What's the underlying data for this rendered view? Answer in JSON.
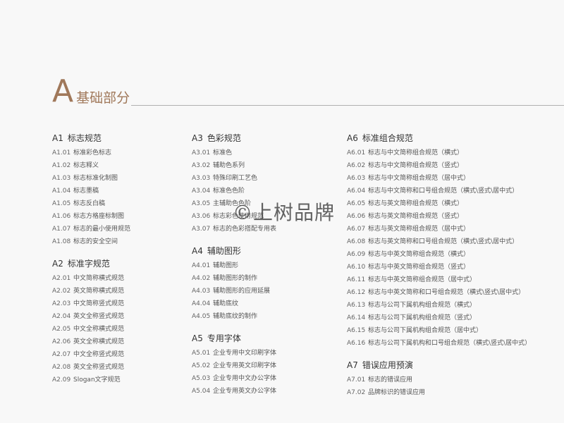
{
  "heading": {
    "letter": "A",
    "title": "基础部分"
  },
  "watermark": "©上树品牌",
  "columns": [
    [
      {
        "code": "A1",
        "title": "标志规范",
        "items": [
          [
            "A1.01",
            "标准彩色标志"
          ],
          [
            "A1.02",
            "标志释义"
          ],
          [
            "A1.03",
            "标志标准化制图"
          ],
          [
            "A1.04",
            "标志墨稿"
          ],
          [
            "A1.05",
            "标志反白稿"
          ],
          [
            "A1.06",
            "标志方格座标制图"
          ],
          [
            "A1.07",
            "标志的最小使用规范"
          ],
          [
            "A1.08",
            "标志的安全空间"
          ]
        ]
      },
      {
        "code": "A2",
        "title": "标准字规范",
        "items": [
          [
            "A2.01",
            "中文简称横式规范"
          ],
          [
            "A2.02",
            "英文简称横式规范"
          ],
          [
            "A2.03",
            "中文简称竖式规范"
          ],
          [
            "A2.04",
            "英文全称竖式规范"
          ],
          [
            "A2.05",
            "中文全称横式规范"
          ],
          [
            "A2.06",
            "英文全称横式规范"
          ],
          [
            "A2.07",
            "中文全称竖式规范"
          ],
          [
            "A2.08",
            "英文全称竖式规范"
          ],
          [
            "A2.09",
            "Slogan文字规范"
          ]
        ]
      }
    ],
    [
      {
        "code": "A3",
        "title": "色彩规范",
        "items": [
          [
            "A3.01",
            "标准色"
          ],
          [
            "A3.02",
            "辅助色系列"
          ],
          [
            "A3.03",
            "特殊印刷工艺色"
          ],
          [
            "A3.04",
            "标准色色阶"
          ],
          [
            "A3.05",
            "主辅助色色阶"
          ],
          [
            "A3.06",
            "标志彩色使用规范"
          ],
          [
            "A3.07",
            "标志的色彩搭配专用表"
          ]
        ]
      },
      {
        "code": "A4",
        "title": "辅助图形",
        "items": [
          [
            "A4.01",
            "辅助图形"
          ],
          [
            "A4.02",
            "辅助图形的制作"
          ],
          [
            "A4.03",
            "辅助图形的应用延展"
          ],
          [
            "A4.04",
            "辅助底纹"
          ],
          [
            "A4.05",
            "辅助底纹的制作"
          ]
        ]
      },
      {
        "code": "A5",
        "title": "专用字体",
        "items": [
          [
            "A5.01",
            "企业专用中文印刷字体"
          ],
          [
            "A5.02",
            "企业专用英文印刷字体"
          ],
          [
            "A5.03",
            "企业专用中文办公字体"
          ],
          [
            "A5.04",
            "企业专用英文办公字体"
          ]
        ]
      }
    ],
    [
      {
        "code": "A6",
        "title": "标准组合规范",
        "items": [
          [
            "A6.01",
            "标志与中文简称组合规范（横式）"
          ],
          [
            "A6.02",
            "标志与中文简称组合规范（竖式）"
          ],
          [
            "A6.03",
            "标志与中文简称组合规范（居中式）"
          ],
          [
            "A6.04",
            "标志与中文简称和口号组合规范（横式\\竖式\\居中式）"
          ],
          [
            "A6.05",
            "标志与英文简称组合规范（横式）"
          ],
          [
            "A6.06",
            "标志与英文简称组合规范（竖式）"
          ],
          [
            "A6.07",
            "标志与英文简称组合规范（居中式）"
          ],
          [
            "A6.08",
            "标志与英文简称和口号组合规范（横式\\竖式\\居中式）"
          ],
          [
            "A6.09",
            "标志与中英文简称组合规范（横式）"
          ],
          [
            "A6.10",
            "标志与中英文简称组合规范（竖式）"
          ],
          [
            "A6.11",
            "标志与中英文简称组合规范（居中式）"
          ],
          [
            "A6.12",
            "标志与中英文简称和口号组合规范（横式\\竖式\\居中式）"
          ],
          [
            "A6.13",
            "标志与公司下属机构组合规范（横式）"
          ],
          [
            "A6.14",
            "标志与公司下属机构组合规范（竖式）"
          ],
          [
            "A6.15",
            "标志与公司下属机构组合规范（居中式）"
          ],
          [
            "A6.16",
            "标志与公司下属机构和口号组合规范（横式\\竖式\\居中式）"
          ]
        ]
      },
      {
        "code": "A7",
        "title": "错误应用预演",
        "items": [
          [
            "A7.01",
            "标志的错误应用"
          ],
          [
            "A7.02",
            "品牌标识的错误应用"
          ]
        ]
      }
    ]
  ]
}
